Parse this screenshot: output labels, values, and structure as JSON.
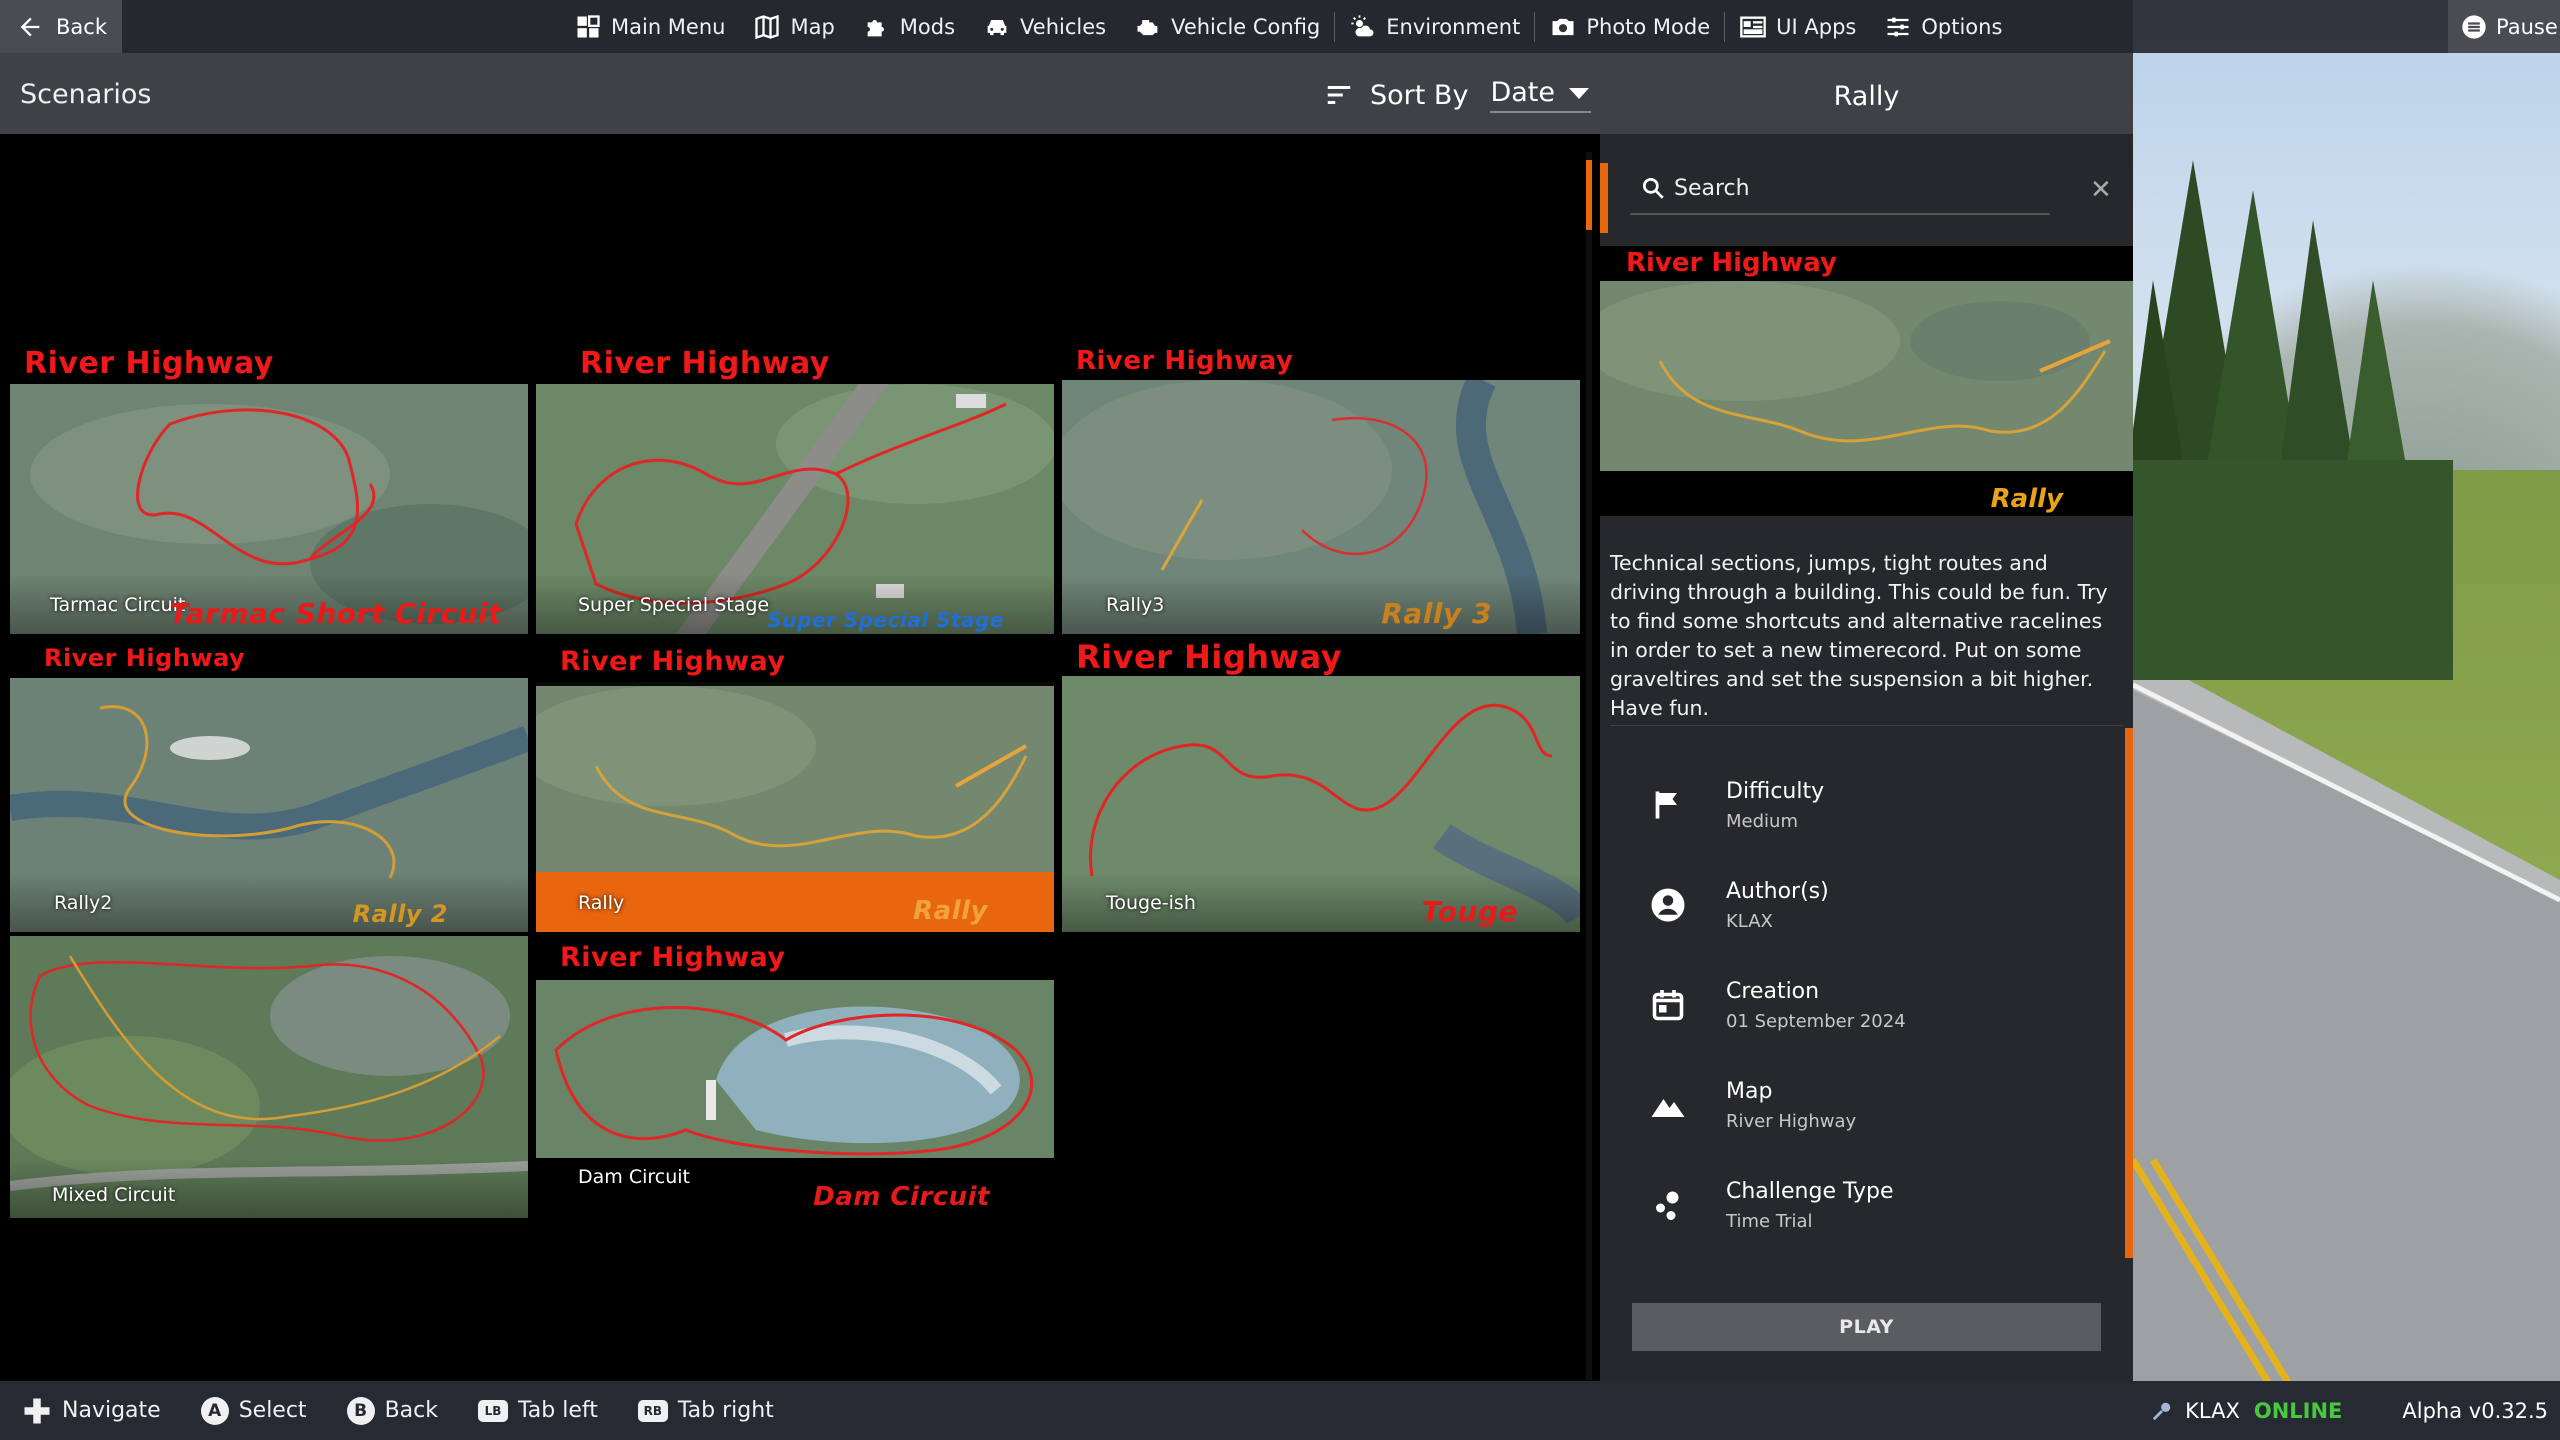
{
  "topbar": {
    "back_label": "Back",
    "pause_label": "Pause",
    "nav": [
      {
        "label": "Main Menu",
        "icon": "main-menu-icon"
      },
      {
        "label": "Map",
        "icon": "map-icon"
      },
      {
        "label": "Mods",
        "icon": "puzzle-icon"
      },
      {
        "label": "Vehicles",
        "icon": "car-icon"
      },
      {
        "label": "Vehicle Config",
        "icon": "engine-icon"
      },
      {
        "label": "Environment",
        "icon": "weather-icon"
      },
      {
        "label": "Photo Mode",
        "icon": "camera-icon"
      },
      {
        "label": "UI Apps",
        "icon": "ui-apps-icon"
      },
      {
        "label": "Options",
        "icon": "sliders-icon"
      }
    ]
  },
  "header": {
    "title": "Scenarios",
    "sort_label": "Sort By",
    "sort_value": "Date"
  },
  "scenarios": [
    {
      "map": "River Highway",
      "caption": "Tarmac Circuit",
      "logo": "Tarmac Short Circuit",
      "logo_color": "#e81a1a"
    },
    {
      "map": "River Highway",
      "caption": "Super Special Stage",
      "logo": "Super Special Stage",
      "logo_color": "#1f6fd6"
    },
    {
      "map": "River Highway",
      "caption": "Rally3",
      "logo": "Rally 3",
      "logo_color": "#c9801d"
    },
    {
      "map": "River Highway",
      "caption": "Rally2",
      "logo": "Rally 2",
      "logo_color": "#d6961f"
    },
    {
      "map": "River Highway",
      "caption": "Rally",
      "logo": "Rally",
      "logo_color": "#f2a23b",
      "selected": true
    },
    {
      "map": "River Highway",
      "caption": "Touge-ish",
      "logo": "Touge",
      "logo_color": "#e51a1a"
    },
    {
      "map": "",
      "caption": "Mixed Circuit",
      "logo": "",
      "logo_color": "#ffffff"
    },
    {
      "map": "River Highway",
      "caption": "Dam Circuit",
      "logo": "Dam Circuit",
      "logo_color": "#e51a1a"
    }
  ],
  "detail": {
    "title": "Rally",
    "search_placeholder": "Search",
    "preview_map": "River Highway",
    "preview_logo": "Rally",
    "description": "Technical sections, jumps, tight routes and driving through a building. This could be fun. Try to find some shortcuts and alternative racelines in order to set a new timerecord. Put on some graveltires and set the suspension a bit higher. Have fun.",
    "info": [
      {
        "label": "Difficulty",
        "value": "Medium",
        "icon": "flag-icon"
      },
      {
        "label": "Author(s)",
        "value": "KLAX",
        "icon": "user-icon"
      },
      {
        "label": "Creation",
        "value": "01 September 2024",
        "icon": "calendar-icon"
      },
      {
        "label": "Map",
        "value": "River Highway",
        "icon": "mountain-icon"
      },
      {
        "label": "Challenge Type",
        "value": "Time Trial",
        "icon": "challenge-icon"
      }
    ],
    "play_label": "PLAY"
  },
  "bottombar": {
    "hints": [
      {
        "glyph": "",
        "label": "Navigate"
      },
      {
        "glyph": "A",
        "label": "Select"
      },
      {
        "glyph": "B",
        "label": "Back"
      },
      {
        "glyph": "LB",
        "label": "Tab left"
      },
      {
        "glyph": "RB",
        "label": "Tab right"
      }
    ],
    "username": "KLAX",
    "online_status": "ONLINE",
    "version": "Alpha v0.32.5"
  },
  "colors": {
    "accent": "#e8660e",
    "map_title": "#f01818",
    "online": "#4ac63f"
  }
}
